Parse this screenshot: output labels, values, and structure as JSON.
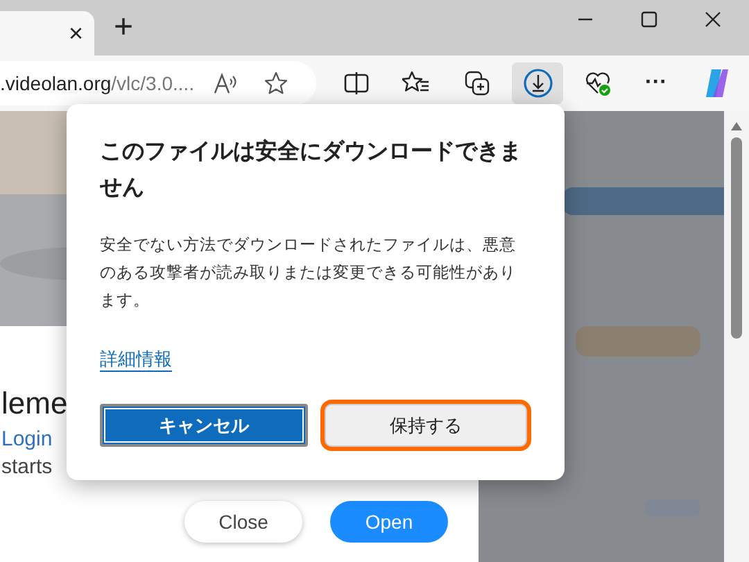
{
  "tab": {
    "close": "×"
  },
  "new_tab": "+",
  "address_bar": {
    "host": ".videolan.org",
    "path": "/vlc/3.0...."
  },
  "toolbar": {
    "more": "···",
    "download_active": true
  },
  "page": {
    "heading": "leme",
    "line_1": "Login",
    "line_2": "starts",
    "buttons": [
      {
        "label": "Close",
        "kind": "secondary"
      },
      {
        "label": "Open",
        "kind": "primary"
      }
    ]
  },
  "dialog": {
    "title": "このファイルは安全にダウンロードできません",
    "message": "安全でない方法でダウンロードされたファイルは、悪意のある攻撃者が読み取りまたは変更できる可能性があります。",
    "link": "詳細情報",
    "buttons": [
      {
        "label": "キャンセル",
        "kind": "primary",
        "highlighted": false
      },
      {
        "label": "保持する",
        "kind": "secondary",
        "highlighted": true
      }
    ]
  }
}
